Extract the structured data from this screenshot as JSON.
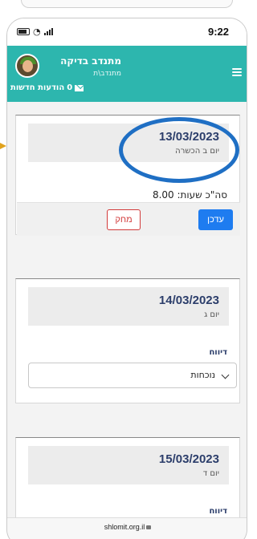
{
  "status_bar": {
    "time": "9:22"
  },
  "header": {
    "user_name": "מתנדב בדיקה",
    "user_role": "מתנדב\\ת",
    "messages_count": "0",
    "messages_label": "הודעות חדשות"
  },
  "cards": [
    {
      "date": "13/03/2023",
      "day": "יום ב הכשרה",
      "hours": "סה\"כ שעות: 8.00",
      "update_label": "עדכן",
      "delete_label": "מחק"
    },
    {
      "date": "14/03/2023",
      "day": "יום ג",
      "report_label": "דיווח",
      "report_value": "נוכחות"
    },
    {
      "date": "15/03/2023",
      "day": "יום ד",
      "report_label": "דיווח"
    }
  ],
  "browser": {
    "url": "shlomit.org.il"
  },
  "colors": {
    "header": "#2db6ae",
    "accent": "#1e7cf0",
    "danger": "#d23a3a",
    "annotation": "#1f6fc4"
  },
  "icons": [
    "battery-icon",
    "wifi-icon",
    "signal-icon",
    "menu-icon",
    "envelope-icon",
    "chevron-down-icon",
    "lock-icon"
  ]
}
